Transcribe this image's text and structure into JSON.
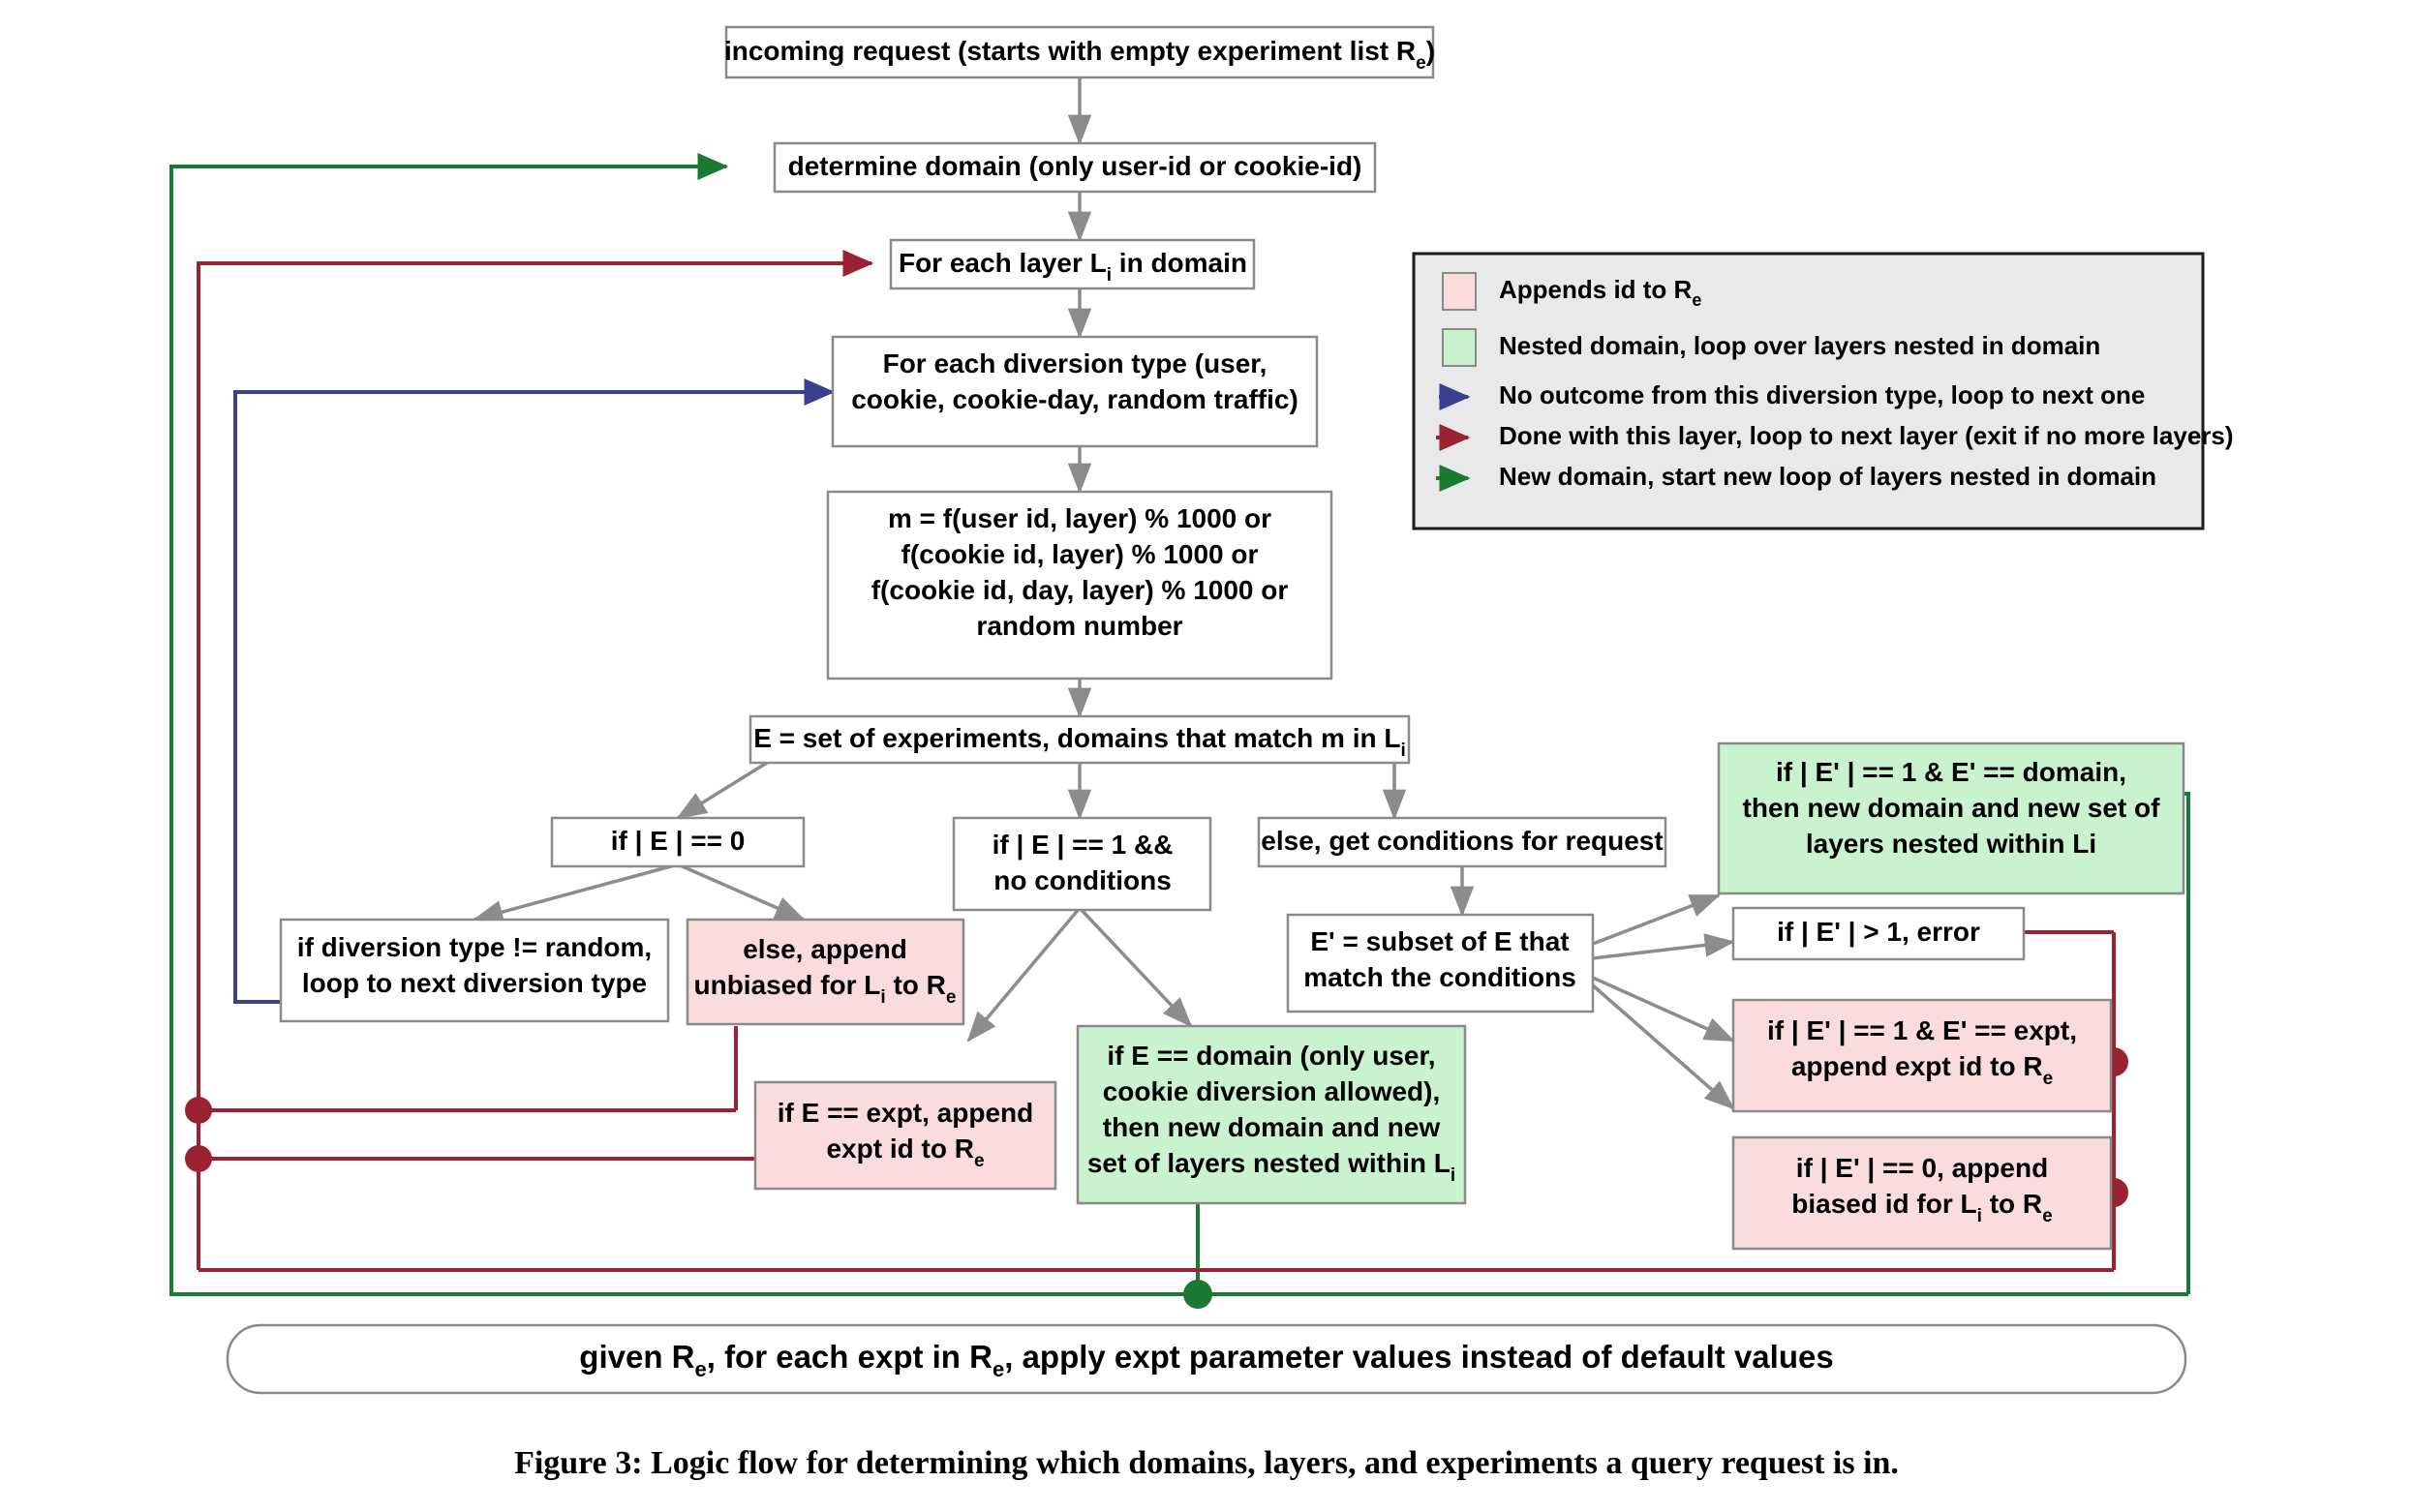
{
  "figure": {
    "caption": "Figure 3: Logic flow for determining which domains, layers, and experiments a query request is in."
  },
  "colors": {
    "pink_fill": "#fadcdc",
    "green_fill": "#c9f3cf",
    "white_fill": "#ffffff",
    "box_stroke": "#8a8a8a",
    "gray_link": "#8c8c8c",
    "red_link": "#9b2232",
    "green_link": "#1a7a31",
    "blue_link": "#3b3f8f",
    "legend_fill": "#e9e9e9"
  },
  "nodes": {
    "incoming_request": {
      "lines": [
        "incoming request (starts with  empty experiment list R@e)"
      ]
    },
    "determine_domain": {
      "lines": [
        "determine domain (only user-id or cookie-id)"
      ]
    },
    "for_each_layer": {
      "lines": [
        "For each layer L@i in domain"
      ]
    },
    "for_each_diversion": {
      "lines": [
        "For each diversion type (user,",
        "cookie, cookie-day, random traffic)"
      ]
    },
    "modulus": {
      "lines": [
        "m = f(user id, layer) % 1000 or",
        "f(cookie id, layer) % 1000 or",
        "f(cookie id, day, layer) % 1000 or",
        "random number"
      ]
    },
    "e_set": {
      "lines": [
        "E = set of experiments, domains that match m in L@i"
      ]
    },
    "if_e_zero": {
      "lines": [
        "if  | E |  == 0"
      ]
    },
    "if_e_one": {
      "lines": [
        "if  | E |  == 1 &&",
        "no conditions"
      ]
    },
    "else_conditions": {
      "lines": [
        "else, get conditions for request"
      ]
    },
    "if_div_not_random": {
      "lines": [
        "if diversion type != random,",
        "loop to next diversion type"
      ]
    },
    "else_append_unbiased": {
      "lines": [
        "else, append",
        "unbiased for L@i to R@e"
      ]
    },
    "if_e_expt": {
      "lines": [
        "if E == expt, append",
        "expt id to R@e"
      ]
    },
    "if_e_domain": {
      "lines": [
        "if E == domain (only user,",
        "cookie diversion allowed),",
        "then new domain and new",
        "set of layers nested within L@i"
      ]
    },
    "eprime_subset": {
      "lines": [
        "E' = subset of E that",
        "match the conditions"
      ]
    },
    "if_ep_one_domain": {
      "lines": [
        "if | E' | == 1 & E' == domain,",
        "then new domain and new set of",
        "layers nested within Li"
      ]
    },
    "if_ep_gt_one": {
      "lines": [
        "if  | E' |  > 1, error"
      ]
    },
    "if_ep_one_expt": {
      "lines": [
        "if  | E' |  == 1 & E' == expt,",
        "append expt id to R@e"
      ]
    },
    "if_ep_zero": {
      "lines": [
        "if  | E' |  == 0, append",
        "biased id for L@i to R@e"
      ]
    },
    "final_apply": {
      "lines": [
        "given R@e, for each expt in R@e, apply expt parameter values instead of default values"
      ]
    }
  },
  "legend": {
    "items": [
      {
        "marker": "swatch-pink",
        "label": "Appends id to R@e"
      },
      {
        "marker": "swatch-green",
        "label": "Nested domain, loop over layers nested in domain"
      },
      {
        "marker": "arrow-blue",
        "label": "No outcome from this diversion type, loop to next one"
      },
      {
        "marker": "arrow-red",
        "label": "Done with this layer, loop to next layer (exit if no more layers)"
      },
      {
        "marker": "arrow-green",
        "label": "New domain, start new loop of layers nested in domain"
      }
    ]
  }
}
